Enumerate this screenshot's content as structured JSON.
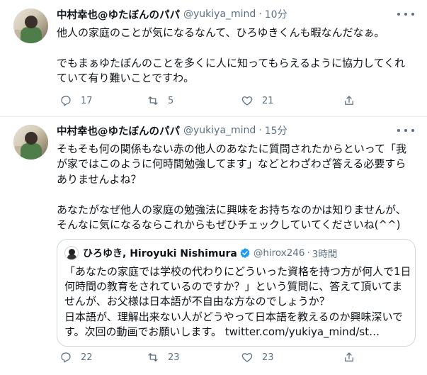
{
  "tweets": [
    {
      "author_name": "中村幸也@ゆたぼんのパパ",
      "handle": "@yukiya_mind",
      "separator": "·",
      "time": "10分",
      "text": "他人の家庭のことが気になるなんて、ひろゆきくんも暇なんだなぁ。\n\nでもまぁゆたぼんのことを多くに人に知ってもらえるように協力してくれていて有り難いことですわ。",
      "reply_count": "17",
      "retweet_count": "5",
      "like_count": "21"
    },
    {
      "author_name": "中村幸也@ゆたぼんのパパ",
      "handle": "@yukiya_mind",
      "separator": "·",
      "time": "15分",
      "text": "そもそも何の関係もない赤の他人のあなたに質問されたからといって「我が家ではこのように何時間勉強してます」などとわざわざ答える必要すらありませんよね？\n\nあなたがなぜ他人の家庭の勉強法に興味をお持ちなのかは知りませんが、そんなに気になるならこれからもぜひチェックしていてくださいね(^^)",
      "reply_count": "22",
      "retweet_count": "23",
      "like_count": "23",
      "quote": {
        "author_name": "ひろゆき, Hiroyuki Nishimura",
        "handle": "@hirox246",
        "separator": "·",
        "time": "3時間",
        "text": "「あなたの家庭では学校の代わりにどういった資格を持つ方が何人で1日何時間の教育をされているのですか？」という質問に、答えて頂いてませんが、お父様は日本語が不自由な方なのでしょうか？\n日本語が、理解出来ない人がどうやって日本語を教えるのか興味深いです。次回の動画でお願いします。 twitter.com/yukiya_mind/st…"
      }
    }
  ],
  "colors": {
    "text": "#0f1419",
    "secondary": "#5b7083",
    "border": "#cfd9de",
    "verified": "#1d9bf0"
  },
  "icons": [
    "more-icon",
    "reply-icon",
    "retweet-icon",
    "like-icon",
    "share-icon",
    "verified-icon"
  ]
}
